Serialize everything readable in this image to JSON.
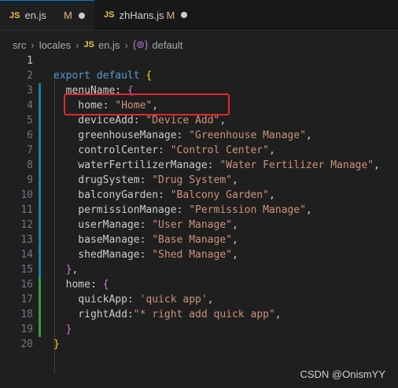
{
  "tabs": [
    {
      "icon": "JS",
      "name": "en.js",
      "status": "M"
    },
    {
      "icon": "JS",
      "name": "zhHans.js",
      "status": "M"
    }
  ],
  "breadcrumb": {
    "items": [
      "src",
      "locales",
      "en.js",
      "default"
    ],
    "js_icon": "JS",
    "symbol_icon": "{⊚}"
  },
  "code": {
    "line_numbers": [
      "1",
      "2",
      "3",
      "4",
      "5",
      "6",
      "7",
      "8",
      "9",
      "10",
      "11",
      "12",
      "13",
      "14",
      "15",
      "16",
      "17",
      "18",
      "19",
      "20"
    ],
    "lines": [
      {
        "parts": []
      },
      {
        "parts": [
          [
            "kw",
            "export default "
          ],
          [
            "br",
            "{"
          ]
        ]
      },
      {
        "parts": [
          [
            "pl",
            "  menuName: "
          ],
          [
            "br2",
            "{"
          ]
        ]
      },
      {
        "parts": [
          [
            "pl",
            "    home: "
          ],
          [
            "str",
            "\"Home\""
          ],
          [
            "pl",
            ","
          ]
        ]
      },
      {
        "parts": [
          [
            "pl",
            "    deviceAdd: "
          ],
          [
            "str",
            "\"Device Add\""
          ],
          [
            "pl",
            ","
          ]
        ]
      },
      {
        "parts": [
          [
            "pl",
            "    greenhouseManage: "
          ],
          [
            "str",
            "\"Greenhouse Manage\""
          ],
          [
            "pl",
            ","
          ]
        ]
      },
      {
        "parts": [
          [
            "pl",
            "    controlCenter: "
          ],
          [
            "str",
            "\"Control Center\""
          ],
          [
            "pl",
            ","
          ]
        ]
      },
      {
        "parts": [
          [
            "pl",
            "    waterFertilizerManage: "
          ],
          [
            "str",
            "\"Water Fertilizer Manage\""
          ],
          [
            "pl",
            ","
          ]
        ]
      },
      {
        "parts": [
          [
            "pl",
            "    drugSystem: "
          ],
          [
            "str",
            "\"Drug System\""
          ],
          [
            "pl",
            ","
          ]
        ]
      },
      {
        "parts": [
          [
            "pl",
            "    balconyGarden: "
          ],
          [
            "str",
            "\"Balcony Garden\""
          ],
          [
            "pl",
            ","
          ]
        ]
      },
      {
        "parts": [
          [
            "pl",
            "    permissionManage: "
          ],
          [
            "str",
            "\"Permission Manage\""
          ],
          [
            "pl",
            ","
          ]
        ]
      },
      {
        "parts": [
          [
            "pl",
            "    userManage: "
          ],
          [
            "str",
            "\"User Manage\""
          ],
          [
            "pl",
            ","
          ]
        ]
      },
      {
        "parts": [
          [
            "pl",
            "    baseManage: "
          ],
          [
            "str",
            "\"Base Manage\""
          ],
          [
            "pl",
            ","
          ]
        ]
      },
      {
        "parts": [
          [
            "pl",
            "    shedManage: "
          ],
          [
            "str",
            "\"Shed Manage\""
          ],
          [
            "pl",
            ","
          ]
        ]
      },
      {
        "parts": [
          [
            "pl",
            "  "
          ],
          [
            "br2",
            "}"
          ],
          [
            "pl",
            ","
          ]
        ]
      },
      {
        "parts": [
          [
            "pl",
            "  home: "
          ],
          [
            "br2",
            "{"
          ]
        ]
      },
      {
        "parts": [
          [
            "pl",
            "    quickApp: "
          ],
          [
            "str",
            "'quick app'"
          ],
          [
            "pl",
            ","
          ]
        ]
      },
      {
        "parts": [
          [
            "pl",
            "    rightAdd:"
          ],
          [
            "str",
            "\"* right add quick app\""
          ],
          [
            "pl",
            ","
          ]
        ]
      },
      {
        "parts": [
          [
            "pl",
            "  "
          ],
          [
            "br2",
            "}"
          ]
        ]
      },
      {
        "parts": [
          [
            "br",
            "}"
          ]
        ]
      }
    ]
  },
  "watermark": "CSDN @OnismYY"
}
